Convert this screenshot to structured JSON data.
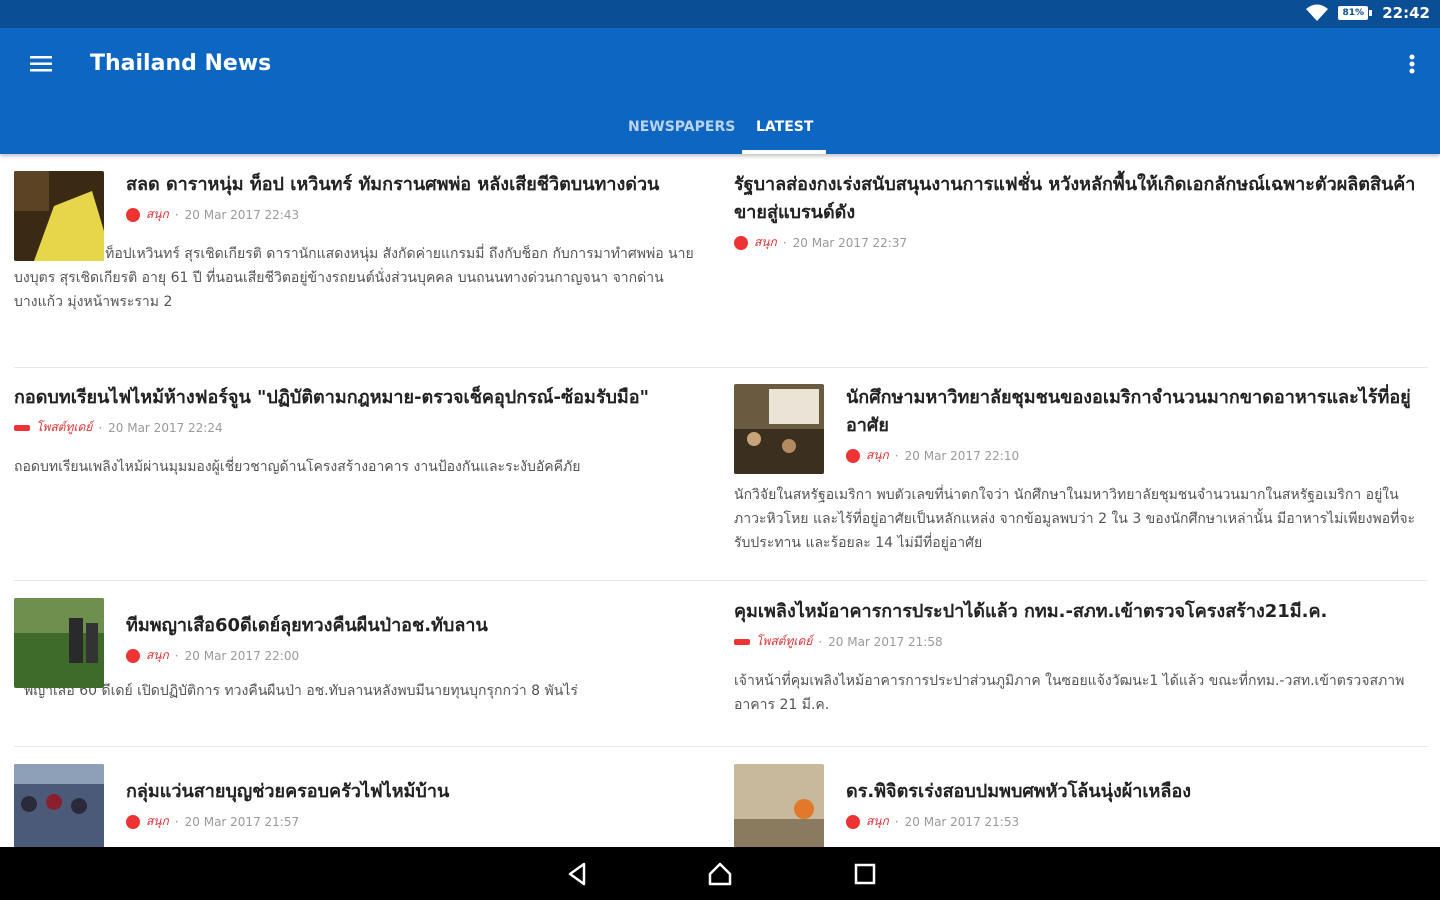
{
  "status": {
    "battery": "81%",
    "time": "22:42"
  },
  "app": {
    "title": "Thailand News"
  },
  "tabs": [
    {
      "label": "NEWSPAPERS",
      "active": false
    },
    {
      "label": "LATEST",
      "active": true
    }
  ],
  "articles": [
    {
      "headline": "สลด ดาราหนุ่ม ท็อป เหวินทร์ ทัมกรานศพพ่อ หลังเสียชีวิตบนทางด่วน",
      "source": "สนุก",
      "time": "20 Mar 2017 22:43",
      "summary": "นายเหวิน หรือ ท็อปเหวินทร์ สุรเชิดเกียรติ ดารานักแสดงหนุ่ม สังกัดค่ายแกรมมี่ ถึงกับช็อก กับการมาทำศพพ่อ นายบงบุตร สุรเชิดเกียรติ อายุ 61 ปี ที่นอนเสียชีวิตอยู่ข้างรถยนต์นั่งส่วนบุคคล บนถนนทางด่วนกาญจนา จากด่านบางแก้ว มุ่งหน้าพระราม 2"
    },
    {
      "headline": "รัฐบาลส่องกงเร่งสนับสนุนงานการแฟชั่น หวังหลักพื้นให้เกิดเอกลักษณ์เฉพาะตัวผลิตสินค้าขายสู่แบรนด์ดัง",
      "source": "สนุก",
      "time": "20 Mar 2017 22:37",
      "summary": ""
    },
    {
      "headline": "กอดบทเรียนไฟไหม้ห้างฟอร์จูน \"ปฏิบัติตามกฎหมาย-ตรวจเช็คอุปกรณ์-ซ้อมรับมือ\"",
      "source": "โพสต์ทูเดย์",
      "time": "20 Mar 2017 22:24",
      "summary": "ถอดบทเรียนเพลิงไหม้ผ่านมุมมองผู้เชี่ยวชาญด้านโครงสร้างอาคาร งานป้องกันและระงับอัคคีภัย"
    },
    {
      "headline": "นักศึกษามหาวิทยาลัยชุมชนของอเมริกาจำนวนมากขาดอาหารและไร้ที่อยู่อาศัย",
      "source": "สนุก",
      "time": "20 Mar 2017 22:10",
      "summary": "นักวิจัยในสหรัฐอเมริกา พบตัวเลขที่น่าตกใจว่า นักศึกษาในมหาวิทยาลัยชุมชนจำนวนมากในสหรัฐอเมริกา อยู่ในภาวะหิวโหย และไร้ที่อยู่อาศัยเป็นหลักแหล่ง จากข้อมูลพบว่า 2 ใน 3 ของนักศึกษาเหล่านั้น มีอาหารไม่เพียงพอที่จะรับประทาน และร้อยละ 14 ไม่มีที่อยู่อาศัย"
    },
    {
      "headline": "ทีมพญาเสือ60ดีเดย์ลุยทวงคืนผืนป่าอช.ทับลาน",
      "source": "สนุก",
      "time": "20 Mar 2017 22:00",
      "summary": "พญาเสือ 60 ดีเดย์ เปิดปฏิบัติการ ทวงคืนผืนป่า อช.ทับลานหลังพบมีนายทุนบุกรุกกว่า 8 พันไร่"
    },
    {
      "headline": "คุมเพลิงไหม้อาคารการประปาได้แล้ว กทม.-สภท.เข้าตรวจโครงสร้าง21มี.ค.",
      "source": "โพสต์ทูเดย์",
      "time": "20 Mar 2017 21:58",
      "summary": "เจ้าหน้าที่คุมเพลิงไหม้อาคารการประปาส่วนภูมิภาค ในซอยแจ้งวัฒนะ1 ได้แล้ว ขณะที่กทม.-วสท.เข้าตรวจสภาพอาคาร 21 มี.ค."
    },
    {
      "headline": "กลุ่มแว่นสายบุญช่วยครอบครัวไฟไหม้บ้าน",
      "source": "สนุก",
      "time": "20 Mar 2017 21:57",
      "summary": ""
    },
    {
      "headline": "ดร.พิจิตรเร่งสอบปมพบศพหัวโล้นนุ่งผ้าเหลือง",
      "source": "สนุก",
      "time": "20 Mar 2017 21:53",
      "summary": ""
    }
  ]
}
